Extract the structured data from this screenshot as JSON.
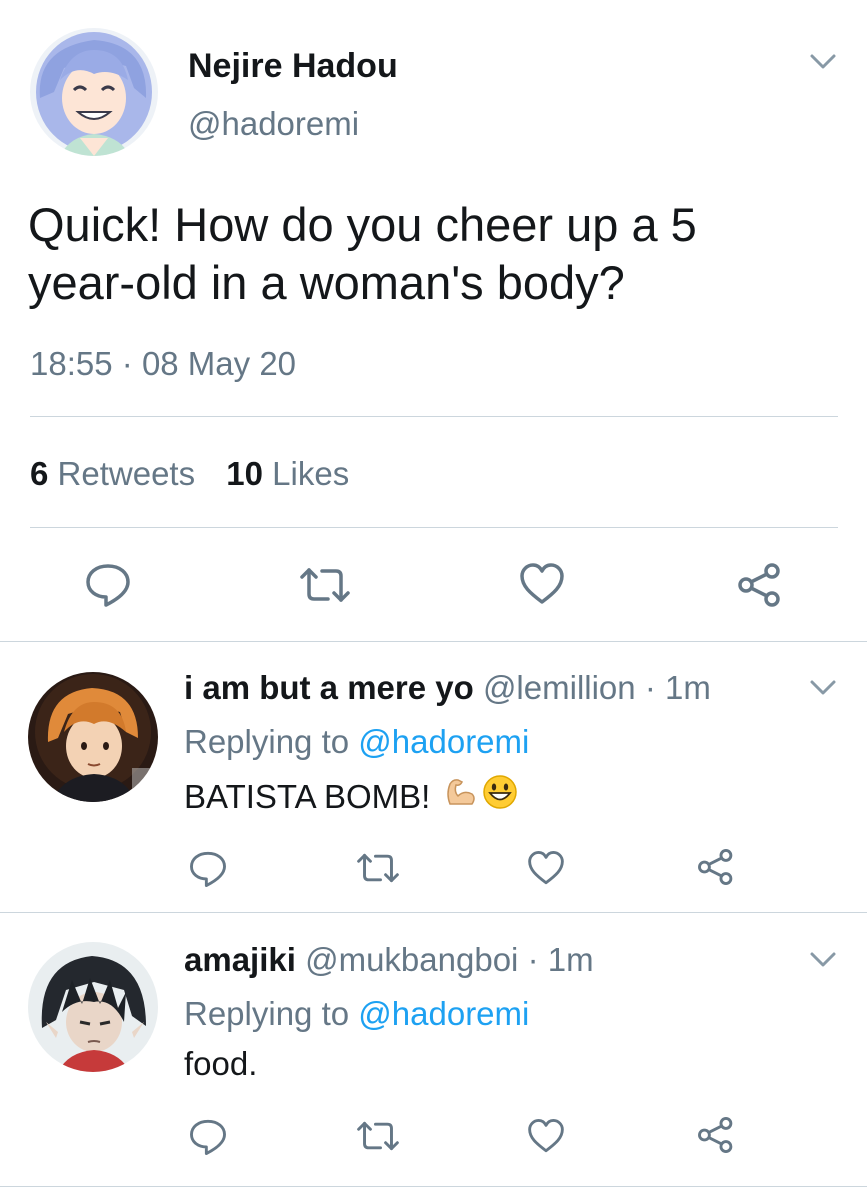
{
  "main_tweet": {
    "display_name": "Nejire Hadou",
    "handle": "@hadoremi",
    "text_line1": "Quick! How do you cheer up a 5",
    "text_line2": "year-old in a woman's body?",
    "time": "18:55",
    "separator": "·",
    "date": "08 May 20",
    "retweets_count": "6",
    "retweets_label": "Retweets",
    "likes_count": "10",
    "likes_label": "Likes"
  },
  "replies": [
    {
      "display_name": "i am but a mere yo",
      "handle": "@lemillion",
      "time_ago": "· 1m",
      "replying_prefix": "Replying to",
      "replying_to": "@hadoremi",
      "text": "BATISTA BOMB!",
      "emojis": [
        "flexed-biceps",
        "grinning-face"
      ]
    },
    {
      "display_name": "amajiki",
      "handle": "@mukbangboi",
      "time_ago": "· 1m",
      "replying_prefix": "Replying to",
      "replying_to": "@hadoremi",
      "text": "food."
    }
  ],
  "icons": [
    "chevron-down-icon",
    "reply-icon",
    "retweet-icon",
    "like-icon",
    "share-icon"
  ],
  "colors": {
    "text": "#14171a",
    "muted": "#657786",
    "link": "#1da1f2",
    "divider": "#ccd6dd"
  }
}
